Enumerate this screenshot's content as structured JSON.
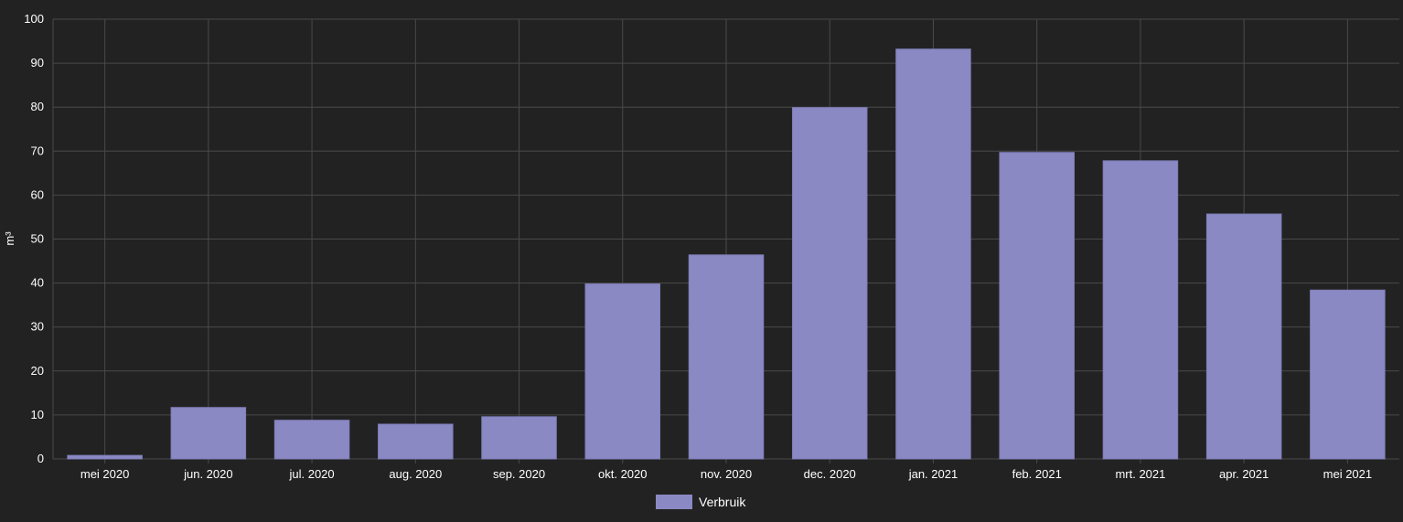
{
  "chart_data": {
    "type": "bar",
    "categories": [
      "mei 2020",
      "jun. 2020",
      "jul. 2020",
      "aug. 2020",
      "sep. 2020",
      "okt. 2020",
      "nov. 2020",
      "dec. 2020",
      "jan. 2021",
      "feb. 2021",
      "mrt. 2021",
      "apr. 2021",
      "mei 2021"
    ],
    "series": [
      {
        "name": "Verbruik",
        "color": "#8b89c4",
        "values": [
          0.8,
          11.7,
          8.8,
          7.9,
          9.6,
          39.8,
          46.4,
          79.9,
          93.2,
          69.7,
          67.8,
          55.7,
          38.4
        ]
      }
    ],
    "ylabel": "m³",
    "xlabel": "",
    "ylim": [
      0,
      100
    ],
    "yticks": [
      0,
      10,
      20,
      30,
      40,
      50,
      60,
      70,
      80,
      90,
      100
    ],
    "grid": true,
    "legend": "bottom-center"
  },
  "colors": {
    "background": "#222222",
    "grid": "#4a4a4a",
    "text": "#ffffff",
    "bar": "#8b89c4"
  }
}
